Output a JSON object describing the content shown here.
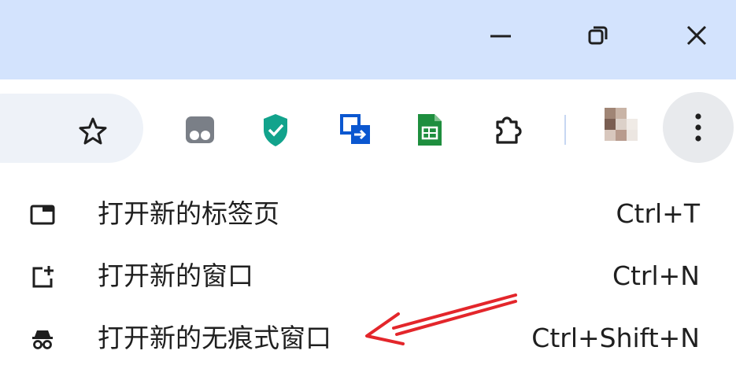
{
  "colors": {
    "titlebar_bg": "#d3e3fd",
    "accent_green": "#1e8e3e",
    "shield_teal": "#12a38c",
    "annotation_arrow": "#e3262b"
  },
  "window_controls": [
    {
      "icon": "minimize-icon"
    },
    {
      "icon": "restore-icon"
    },
    {
      "icon": "close-icon"
    }
  ],
  "toolbar": {
    "icons": [
      "bookmark-star-icon",
      "tab-extension-icon",
      "shield-extension-icon",
      "transfer-extension-icon",
      "sheets-extension-icon",
      "extensions-puzzle-icon",
      "profile-avatar",
      "more-menu-icon"
    ]
  },
  "menu": {
    "items": [
      {
        "label": "打开新的标签页",
        "shortcut": "Ctrl+T",
        "icon": "new-tab-icon"
      },
      {
        "label": "打开新的窗口",
        "shortcut": "Ctrl+N",
        "icon": "new-window-icon"
      },
      {
        "label": "打开新的无痕式窗口",
        "shortcut": "Ctrl+Shift+N",
        "icon": "incognito-icon"
      }
    ]
  }
}
